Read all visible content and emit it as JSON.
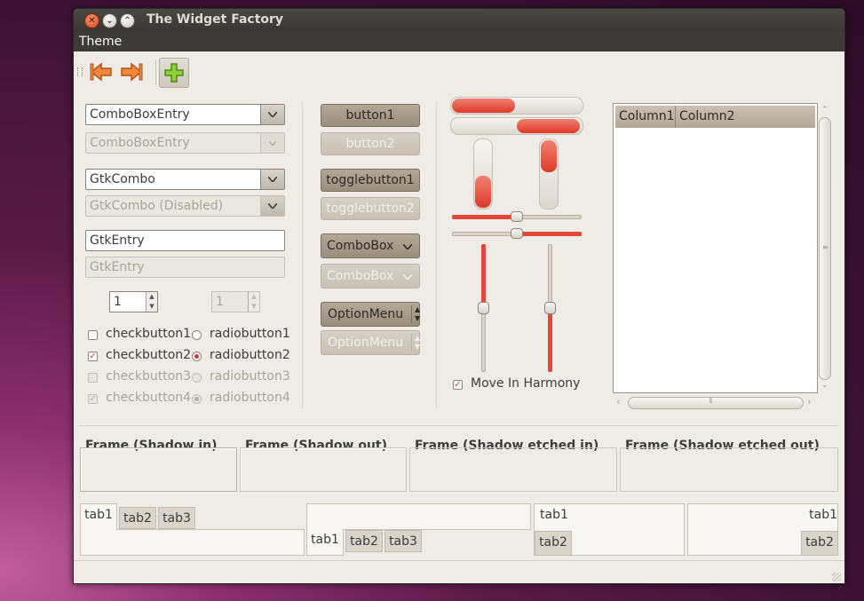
{
  "window": {
    "title": "The Widget Factory"
  },
  "menubar": {
    "items": [
      "Theme"
    ]
  },
  "toolbar": {
    "buttons": [
      "back-icon",
      "forward-icon",
      "add-icon"
    ]
  },
  "left": {
    "combo_entry": "ComboBoxEntry",
    "combo_entry_disabled": "ComboBoxEntry",
    "gtk_combo": "GtkCombo",
    "gtk_combo_disabled": "GtkCombo (Disabled)",
    "entry": "GtkEntry",
    "entry_disabled": "GtkEntry",
    "spin_value": "1",
    "spin_disabled_value": "1",
    "checks": [
      "checkbutton1",
      "checkbutton2",
      "checkbutton3",
      "checkbutton4"
    ],
    "radios": [
      "radiobutton1",
      "radiobutton2",
      "radiobutton3",
      "radiobutton4"
    ]
  },
  "buttons": {
    "button1": "button1",
    "button2": "button2",
    "toggle1": "togglebutton1",
    "toggle2": "togglebutton2",
    "combo1": "ComboBox",
    "combo2": "ComboBox",
    "option1": "OptionMenu",
    "option2": "OptionMenu"
  },
  "sliders": {
    "progress_h1": 0.5,
    "progress_h2": 0.5,
    "progress_v1": 0.5,
    "progress_v2": 0.5,
    "hscale1": 0.5,
    "hscale2": 0.5,
    "vscale1": 0.5,
    "vscale2": 0.5,
    "move_in_harmony": "Move In Harmony"
  },
  "tree": {
    "columns": [
      "Column1",
      "Column2"
    ]
  },
  "frames": [
    "Frame (Shadow in)",
    "Frame (Shadow out)",
    "Frame (Shadow etched in)",
    "Frame (Shadow etched out)"
  ],
  "notebooks": {
    "nb1": [
      "tab1",
      "tab2",
      "tab3"
    ],
    "nb2": [
      "tab1",
      "tab2",
      "tab3"
    ],
    "nb3": [
      "tab1",
      "tab2"
    ],
    "nb4": [
      "tab1",
      "tab2"
    ]
  },
  "colors": {
    "accent": "#e2473a",
    "title_bg": "#3c3b37",
    "window_bg": "#efebe6"
  }
}
